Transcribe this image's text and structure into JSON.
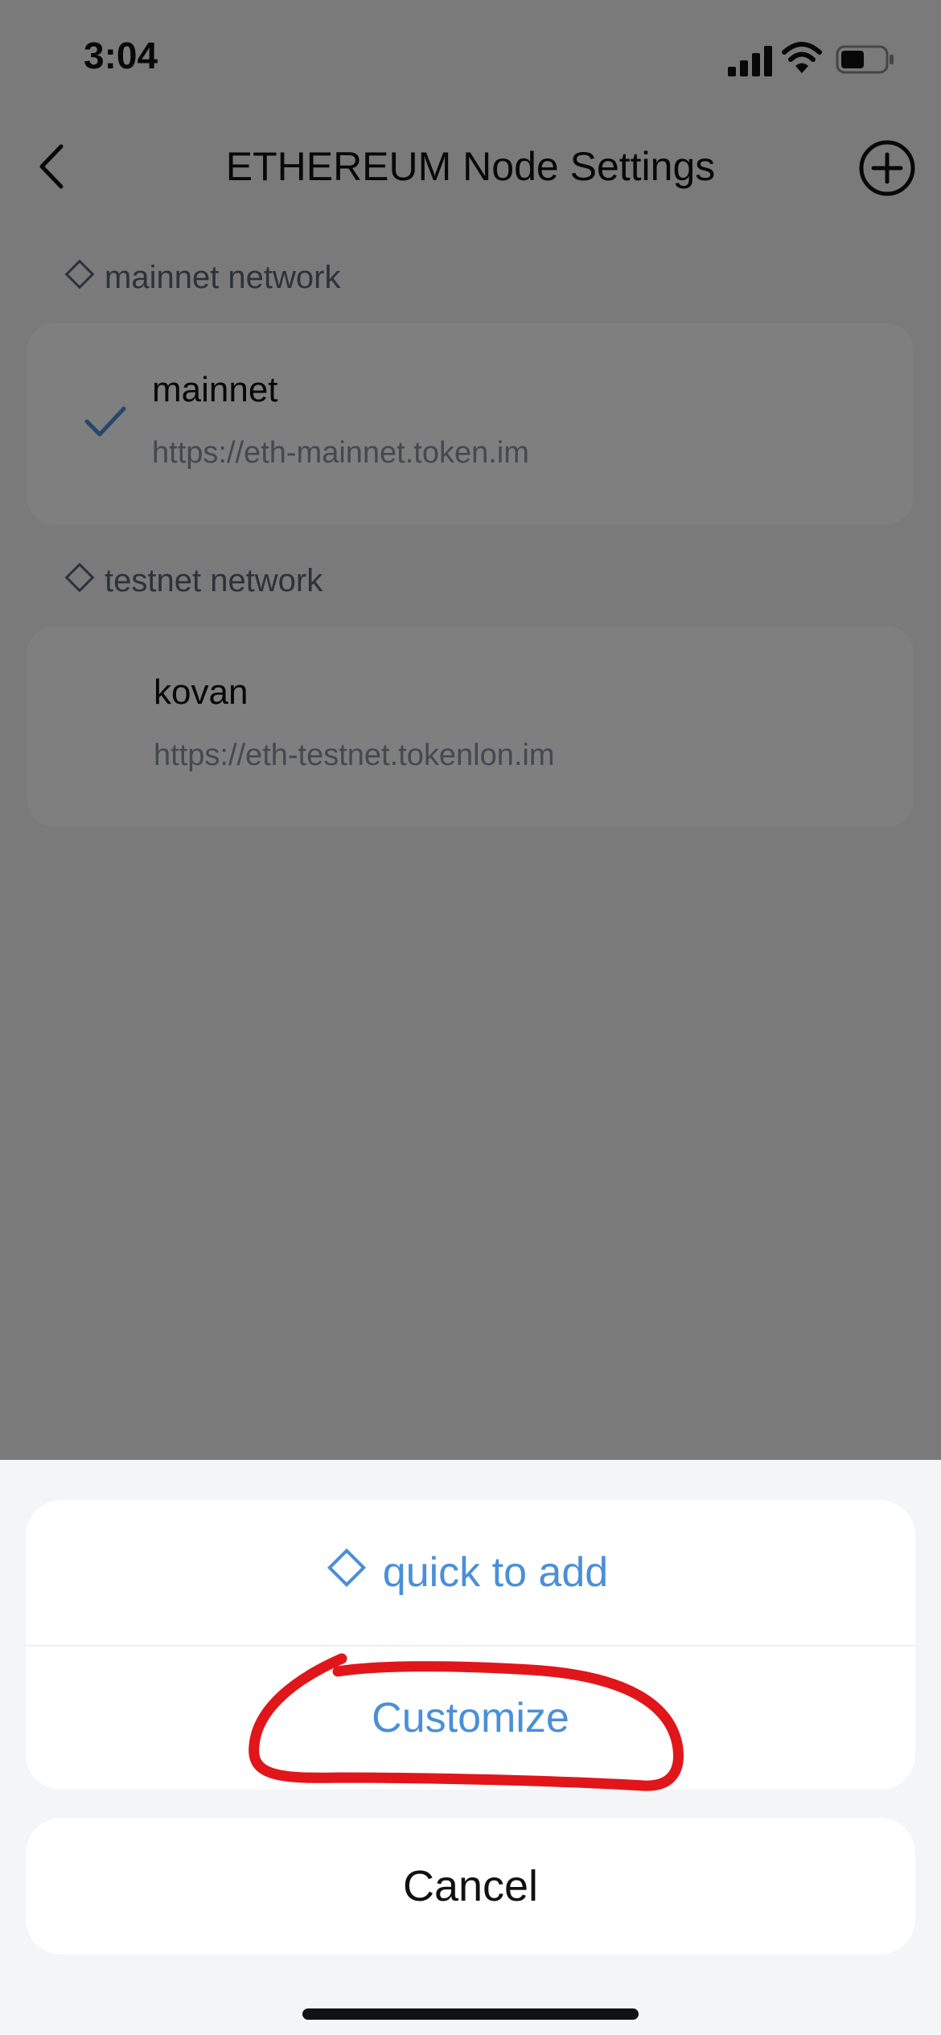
{
  "status_bar": {
    "time": "3:04"
  },
  "nav": {
    "title": "ETHEREUM Node Settings"
  },
  "sections": [
    {
      "title": "mainnet network",
      "node": {
        "name": "mainnet",
        "url": "https://eth-mainnet.token.im",
        "selected": true
      }
    },
    {
      "title": "testnet network",
      "node": {
        "name": "kovan",
        "url": "https://eth-testnet.tokenlon.im",
        "selected": false
      }
    }
  ],
  "action_sheet": {
    "quick_add_label": "quick to add",
    "customize_label": "Customize",
    "cancel_label": "Cancel"
  },
  "colors": {
    "accent": "#4a8fd8",
    "annotation": "#e0161b"
  },
  "icons": [
    "signal-icon",
    "wifi-icon",
    "battery-icon",
    "back-arrow-icon",
    "add-circle-icon",
    "diamond-icon",
    "checkmark-icon"
  ]
}
